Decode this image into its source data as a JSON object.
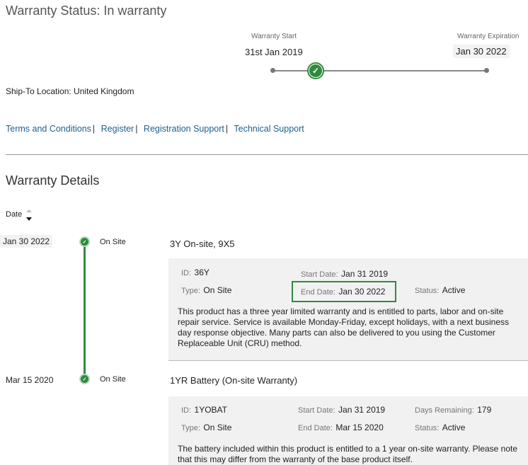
{
  "header": {
    "title": "Warranty Status: In warranty"
  },
  "timeline": {
    "start_label": "Warranty Start",
    "start_date": "31st Jan 2019",
    "end_label": "Warranty Expiration",
    "end_date": "Jan 30 2022"
  },
  "ship_to": "Ship-To Location: United Kingdom",
  "links": [
    "Terms and Conditions",
    "Register",
    "Registration Support",
    "Technical Support"
  ],
  "details": {
    "heading": "Warranty Details",
    "sort_label": "Date",
    "items": [
      {
        "date": "Jan 30 2022",
        "type": "On Site",
        "title": "3Y On-site, 9X5",
        "id_label": "ID:",
        "id": "36Y",
        "start_label": "Start Date:",
        "start": "Jan 31 2019",
        "type_label": "Type:",
        "type_value": "On Site",
        "end_label": "End Date:",
        "end": "Jan 30 2022",
        "status_label": "Status:",
        "status": "Active",
        "description": "This product has a three year limited warranty and is entitled to parts, labor and on-site repair service. Service is available Monday-Friday, except holidays, with a next business day response objective. Many parts can also be delivered to you using the Customer Replaceable Unit (CRU) method."
      },
      {
        "date": "Mar 15 2020",
        "type": "On Site",
        "title": "1YR Battery (On-site Warranty)",
        "id_label": "ID:",
        "id": "1YOBAT",
        "start_label": "Start Date:",
        "start": "Jan 31 2019",
        "days_label": "Days Remaining:",
        "days": "179",
        "type_label": "Type:",
        "type_value": "On Site",
        "end_label": "End Date:",
        "end": "Mar 15 2020",
        "status_label": "Status:",
        "status": "Active",
        "description": "The battery included within this product is entitled to a 1 year on-site warranty. Please note that this may differ from the warranty of the base product itself."
      }
    ]
  },
  "colors": {
    "accent_green": "#2f8a3e",
    "link_blue": "#1f5f8b"
  }
}
